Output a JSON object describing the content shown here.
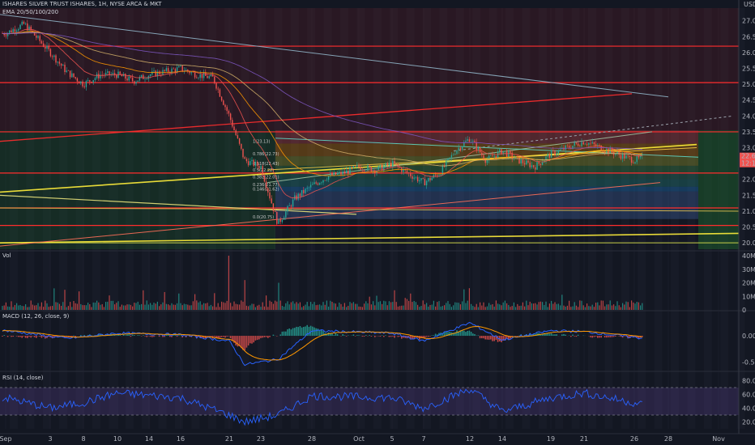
{
  "header": {
    "title": "ISHARES SILVER TRUST ISHARES, 1H, NYSE ARCA & MKT",
    "ema": "EMA 20/50/100/200"
  },
  "price_axis": {
    "unit": "USD",
    "ticks": [
      "27.00",
      "26.50",
      "26.00",
      "25.50",
      "25.00",
      "24.50",
      "24.00",
      "23.50",
      "23.00",
      "22.50",
      "22.00",
      "21.50",
      "21.00",
      "20.50",
      "20.00"
    ],
    "last_price": "22.69",
    "countdown": "12:19"
  },
  "fib_labels": [
    "1(23.13)",
    "0.786(22.73)",
    "0.618(22.43)",
    "0.5(22.22)",
    "0.382(22.01)",
    "0.236(21.77)",
    "0.146(21.62)",
    "0.0(20.75)"
  ],
  "volume": {
    "label": "Vol",
    "ticks": [
      "40M",
      "30M",
      "20M",
      "10M",
      "0"
    ]
  },
  "macd": {
    "label": "MACD (12, 26, close, 9)",
    "ticks": [
      "0.00",
      "-0.50"
    ]
  },
  "rsi": {
    "label": "RSI (14, close)",
    "ticks": [
      "80.00",
      "60.00",
      "40.00",
      "20.00"
    ]
  },
  "time_axis": {
    "ticks": [
      "Sep",
      "3",
      "8",
      "10",
      "14",
      "16",
      "21",
      "23",
      "28",
      "Oct",
      "5",
      "7",
      "12",
      "14",
      "19",
      "21",
      "26",
      "28",
      "Nov"
    ]
  },
  "colors": {
    "background": "#131722",
    "up": "#26a69a",
    "down": "#ef5350",
    "resistance": "#ff2d2d",
    "trend_yellow": "#ffee3a",
    "macd_line": "#2962ff",
    "signal_line": "#ff9800",
    "rsi_line": "#2962ff",
    "rsi_band": "#7e57c2"
  },
  "chart_data": [
    {
      "type": "candlestick",
      "name": "price",
      "yunit": "USD",
      "ylim": [
        19.8,
        27.4
      ],
      "x_period": "2020-09-01 to 2020-10-27, 1-hour bars",
      "anchors": [
        {
          "t": "Sep 1",
          "p": 26.6
        },
        {
          "t": "Sep 2",
          "p": 26.9
        },
        {
          "t": "Sep 3",
          "p": 26.0
        },
        {
          "t": "Sep 4",
          "p": 25.4
        },
        {
          "t": "Sep 8",
          "p": 25.0
        },
        {
          "t": "Sep 9",
          "p": 25.3
        },
        {
          "t": "Sep 10",
          "p": 25.3
        },
        {
          "t": "Sep 11",
          "p": 25.1
        },
        {
          "t": "Sep 14",
          "p": 25.3
        },
        {
          "t": "Sep 15",
          "p": 25.4
        },
        {
          "t": "Sep 16",
          "p": 25.5
        },
        {
          "t": "Sep 17",
          "p": 25.3
        },
        {
          "t": "Sep 18",
          "p": 25.2
        },
        {
          "t": "Sep 21",
          "p": 24.0
        },
        {
          "t": "Sep 22",
          "p": 22.6
        },
        {
          "t": "Sep 23",
          "p": 22.4
        },
        {
          "t": "Sep 24",
          "p": 20.6
        },
        {
          "t": "Sep 25",
          "p": 21.4
        },
        {
          "t": "Sep 28",
          "p": 21.8
        },
        {
          "t": "Sep 29",
          "p": 22.1
        },
        {
          "t": "Sep 30",
          "p": 22.2
        },
        {
          "t": "Oct 1",
          "p": 22.4
        },
        {
          "t": "Oct 2",
          "p": 22.3
        },
        {
          "t": "Oct 5",
          "p": 22.5
        },
        {
          "t": "Oct 6",
          "p": 22.2
        },
        {
          "t": "Oct 7",
          "p": 21.9
        },
        {
          "t": "Oct 8",
          "p": 22.2
        },
        {
          "t": "Oct 9",
          "p": 22.9
        },
        {
          "t": "Oct 12",
          "p": 23.3
        },
        {
          "t": "Oct 13",
          "p": 22.6
        },
        {
          "t": "Oct 14",
          "p": 22.9
        },
        {
          "t": "Oct 15",
          "p": 22.6
        },
        {
          "t": "Oct 16",
          "p": 22.4
        },
        {
          "t": "Oct 19",
          "p": 22.8
        },
        {
          "t": "Oct 20",
          "p": 23.0
        },
        {
          "t": "Oct 21",
          "p": 23.2
        },
        {
          "t": "Oct 22",
          "p": 23.0
        },
        {
          "t": "Oct 23",
          "p": 22.8
        },
        {
          "t": "Oct 26",
          "p": 22.6
        },
        {
          "t": "Oct 27",
          "p": 22.69
        }
      ],
      "horizontal_levels": [
        26.2,
        25.05,
        23.5,
        22.2,
        21.1,
        20.55
      ],
      "fib_levels": [
        23.13,
        22.73,
        22.43,
        22.22,
        22.01,
        21.77,
        21.62,
        20.75
      ]
    },
    {
      "type": "bar",
      "name": "Vol",
      "ylim": [
        0,
        40000000
      ],
      "notable_spikes": [
        {
          "t": "Sep 21",
          "v": 40000000
        },
        {
          "t": "Sep 22",
          "v": 22000000
        },
        {
          "t": "Sep 24",
          "v": 20000000
        },
        {
          "t": "Oct 12",
          "v": 16000000
        }
      ]
    },
    {
      "type": "line",
      "name": "MACD (12, 26, close, 9)",
      "ylim": [
        -0.65,
        0.45
      ],
      "anchors": [
        {
          "t": "Sep 1",
          "v": 0.1
        },
        {
          "t": "Sep 4",
          "v": -0.05
        },
        {
          "t": "Sep 10",
          "v": 0.05
        },
        {
          "t": "Sep 16",
          "v": 0.02
        },
        {
          "t": "Sep 21",
          "v": -0.1
        },
        {
          "t": "Sep 22",
          "v": -0.55
        },
        {
          "t": "Sep 24",
          "v": -0.45
        },
        {
          "t": "Sep 28",
          "v": 0.1
        },
        {
          "t": "Oct 5",
          "v": 0.05
        },
        {
          "t": "Oct 7",
          "v": -0.1
        },
        {
          "t": "Oct 12",
          "v": 0.25
        },
        {
          "t": "Oct 14",
          "v": -0.08
        },
        {
          "t": "Oct 19",
          "v": 0.1
        },
        {
          "t": "Oct 21",
          "v": 0.08
        },
        {
          "t": "Oct 27",
          "v": -0.05
        }
      ]
    },
    {
      "type": "line",
      "name": "RSI (14, close)",
      "ylim": [
        10,
        90
      ],
      "band": [
        30,
        70
      ],
      "anchors": [
        {
          "t": "Sep 1",
          "v": 55
        },
        {
          "t": "Sep 3",
          "v": 40
        },
        {
          "t": "Sep 8",
          "v": 48
        },
        {
          "t": "Sep 10",
          "v": 62
        },
        {
          "t": "Sep 16",
          "v": 55
        },
        {
          "t": "Sep 21",
          "v": 30
        },
        {
          "t": "Sep 22",
          "v": 20
        },
        {
          "t": "Sep 24",
          "v": 30
        },
        {
          "t": "Sep 28",
          "v": 58
        },
        {
          "t": "Oct 5",
          "v": 55
        },
        {
          "t": "Oct 7",
          "v": 40
        },
        {
          "t": "Oct 12",
          "v": 68
        },
        {
          "t": "Oct 14",
          "v": 35
        },
        {
          "t": "Oct 19",
          "v": 55
        },
        {
          "t": "Oct 21",
          "v": 62
        },
        {
          "t": "Oct 27",
          "v": 45
        }
      ]
    }
  ]
}
